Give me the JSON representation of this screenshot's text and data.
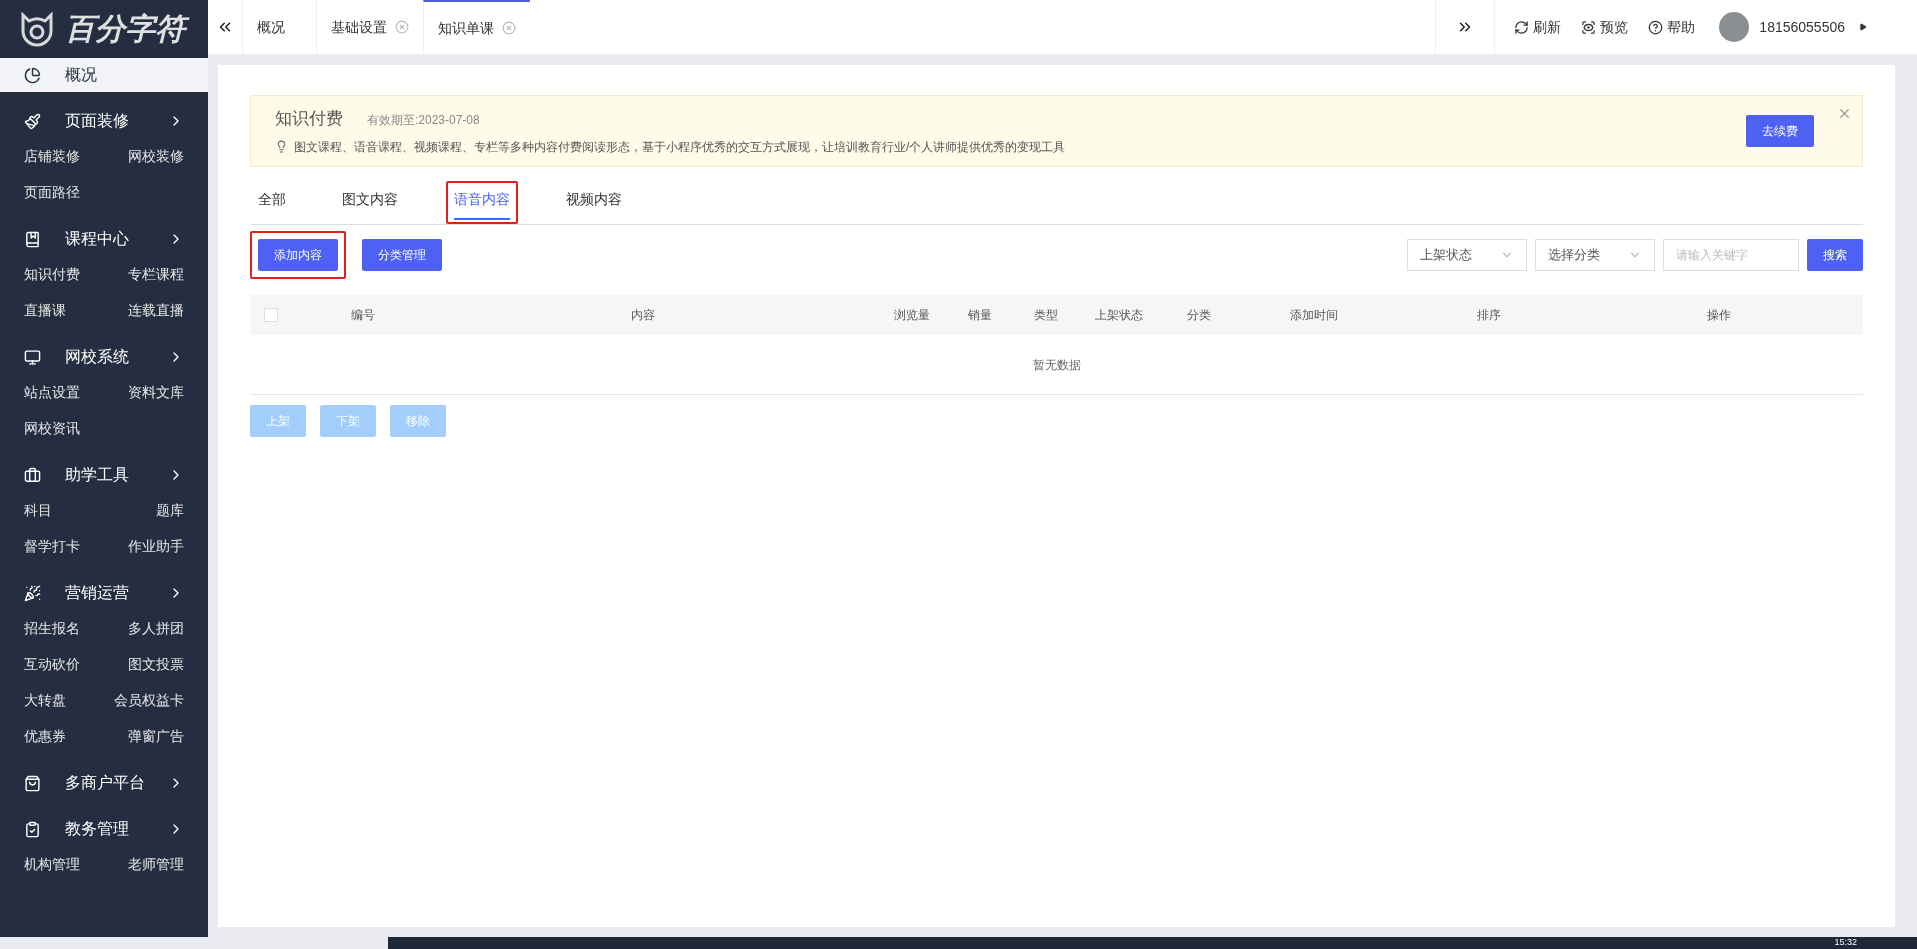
{
  "logo": {
    "text": "百分字符"
  },
  "top_tabs": [
    {
      "label": "概况",
      "closable": false,
      "selected": false
    },
    {
      "label": "基础设置",
      "closable": true,
      "selected": false
    },
    {
      "label": "知识单课",
      "closable": true,
      "selected": true
    }
  ],
  "top_actions": [
    {
      "kind": "refresh",
      "label": "刷新"
    },
    {
      "kind": "preview",
      "label": "预览"
    },
    {
      "kind": "help",
      "label": "帮助"
    }
  ],
  "user": {
    "phone": "18156055506"
  },
  "sidebar": {
    "items": [
      {
        "kind": "overview",
        "label": "概况",
        "selected": true
      },
      {
        "kind": "brush",
        "label": "页面装修",
        "selected": false,
        "children": [
          "店铺装修",
          "网校装修",
          "页面路径"
        ]
      },
      {
        "kind": "book",
        "label": "课程中心",
        "selected": false,
        "children": [
          "知识付费",
          "专栏课程",
          "直播课",
          "连载直播"
        ]
      },
      {
        "kind": "monitor",
        "label": "网校系统",
        "selected": false,
        "children": [
          "站点设置",
          "资料文库",
          "网校资讯"
        ]
      },
      {
        "kind": "toolbox",
        "label": "助学工具",
        "selected": false,
        "children": [
          "科目",
          "题库",
          "督学打卡",
          "作业助手"
        ]
      },
      {
        "kind": "party",
        "label": "营销运营",
        "selected": false,
        "children": [
          "招生报名",
          "多人拼团",
          "互动砍价",
          "图文投票",
          "大转盘",
          "会员权益卡",
          "优惠券",
          "弹窗广告"
        ]
      },
      {
        "kind": "bag",
        "label": "多商户平台",
        "selected": false
      },
      {
        "kind": "clipboard",
        "label": "教务管理",
        "selected": false,
        "children": [
          "机构管理",
          "老师管理"
        ]
      }
    ]
  },
  "banner": {
    "title": "知识付费",
    "expiry": "有效期至:2023-07-08",
    "description": "图文课程、语音课程、视频课程、专栏等多种内容付费阅读形态，基于小程序优秀的交互方式展现，让培训教育行业/个人讲师提供优秀的变现工具",
    "button": "去续费"
  },
  "content_tabs": [
    {
      "label": "全部",
      "selected": false,
      "highlighted": false
    },
    {
      "label": "图文内容",
      "selected": false,
      "highlighted": false
    },
    {
      "label": "语音内容",
      "selected": true,
      "highlighted": true
    },
    {
      "label": "视频内容",
      "selected": false,
      "highlighted": false
    }
  ],
  "toolbar": {
    "buttons": [
      {
        "label": "添加内容",
        "highlighted": true
      },
      {
        "label": "分类管理",
        "highlighted": false
      }
    ],
    "filters": [
      "上架状态",
      "选择分类"
    ],
    "search": {
      "placeholder": "请输入关键字"
    },
    "search_button": "搜索"
  },
  "table": {
    "checked": false,
    "columns": [
      "编号",
      "内容",
      "浏览量",
      "销量",
      "类型",
      "上架状态",
      "分类",
      "添加时间",
      "排序",
      "操作"
    ],
    "empty_text": "暂无数据"
  },
  "bulk_actions": [
    {
      "label": "上架",
      "disabled": true
    },
    {
      "label": "下架",
      "disabled": true
    },
    {
      "label": "移除",
      "disabled": true
    }
  ],
  "taskbar": {
    "time": "15:32"
  }
}
